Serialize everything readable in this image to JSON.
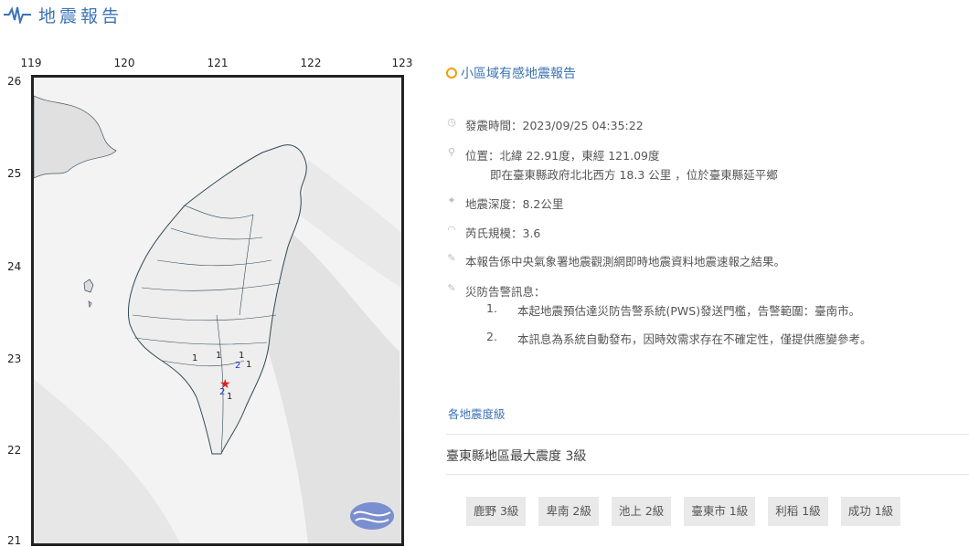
{
  "header": {
    "title": "地震報告"
  },
  "map": {
    "lon_ticks": [
      "119",
      "120",
      "121",
      "122",
      "123"
    ],
    "lat_ticks": [
      "26",
      "25",
      "24",
      "23",
      "22",
      "21"
    ],
    "intensity_labels": [
      {
        "text": "1",
        "color": "#222"
      },
      {
        "text": "1",
        "color": "#222"
      },
      {
        "text": "1",
        "color": "#222"
      },
      {
        "text": "2",
        "color": "#2233cc"
      },
      {
        "text": "1",
        "color": "#222"
      },
      {
        "text": "2",
        "color": "#2233cc"
      },
      {
        "text": "1",
        "color": "#222"
      }
    ]
  },
  "report": {
    "title": "小區域有感地震報告",
    "time": "發震時間：2023/09/25 04:35:22",
    "location": "位置：北緯 22.91度，東經 121.09度",
    "location_sub": "即在臺東縣政府北北西方 18.3 公里 ，位於臺東縣延平鄉",
    "depth": "地震深度：8.2公里",
    "magnitude": "芮氏規模：3.6",
    "source": "本報告係中央氣象署地震觀測網即時地震資料地震速報之結果。",
    "pws_title": "災防告警訊息：",
    "pws_items": [
      {
        "num": "1.",
        "text": "本起地震預估達災防告警系統(PWS)發送門檻，告警範圍：臺南市。"
      },
      {
        "num": "2.",
        "text": "本訊息為系統自動發布，因時效需求存在不確定性，僅提供應變參考。"
      }
    ],
    "grades_title": "各地震度級",
    "max_intensity": "臺東縣地區最大震度 3級",
    "grades": [
      "鹿野 3級",
      "卑南 2級",
      "池上 2級",
      "臺東市 1級",
      "利稻 1級",
      "成功 1級"
    ]
  },
  "colors": {
    "accent": "#3d73b5",
    "orange": "#f0a000",
    "epicenter": "#e02020"
  }
}
